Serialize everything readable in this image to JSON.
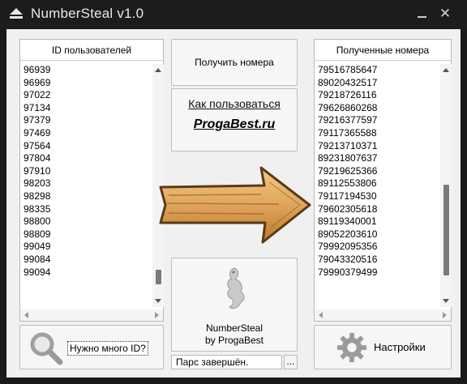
{
  "window": {
    "title": "NumberSteal v1.0"
  },
  "left_panel": {
    "header": "ID пользователей",
    "items": [
      "96939",
      "96969",
      "97022",
      "97134",
      "97379",
      "97469",
      "97564",
      "97804",
      "97910",
      "98203",
      "98298",
      "98335",
      "98800",
      "98809",
      "99049",
      "99084",
      "99094"
    ],
    "scroll_position": 0.95
  },
  "center": {
    "get_numbers_label": "Получить номера",
    "how_to_label": "Как пользоваться",
    "site_label": "ProgaBest.ru",
    "app_name": "NumberSteal",
    "app_by": "by ProgaBest",
    "status_text": "Парс завершён.",
    "dots_label": "..."
  },
  "right_panel": {
    "header": "Полученные номера",
    "items": [
      "79516785647",
      "89020432517",
      "79218726116",
      "79626860268",
      "79216377597",
      "79117365588",
      "79213710371",
      "89231807637",
      "79219625366",
      "89112553806",
      "79117194530",
      "79602305618",
      "89119340001",
      "89052203610",
      "79992095356",
      "79043320516",
      "79990379499"
    ],
    "scroll_position": 0.85
  },
  "bottom_left": {
    "need_many_label": "Нужно много ID?"
  },
  "bottom_right": {
    "settings_label": "Настройки"
  },
  "icons": [
    "eject-icon",
    "minimize-icon",
    "close-icon",
    "magnifier-icon",
    "gear-icon",
    "lizard-logo-icon",
    "arrow-right-icon"
  ],
  "colors": {
    "titlebar": "#1c1c1c",
    "client": "#f0f0f0",
    "arrow_wood": "#e0a55a",
    "scroll_thumb": "#7a7a7a"
  }
}
